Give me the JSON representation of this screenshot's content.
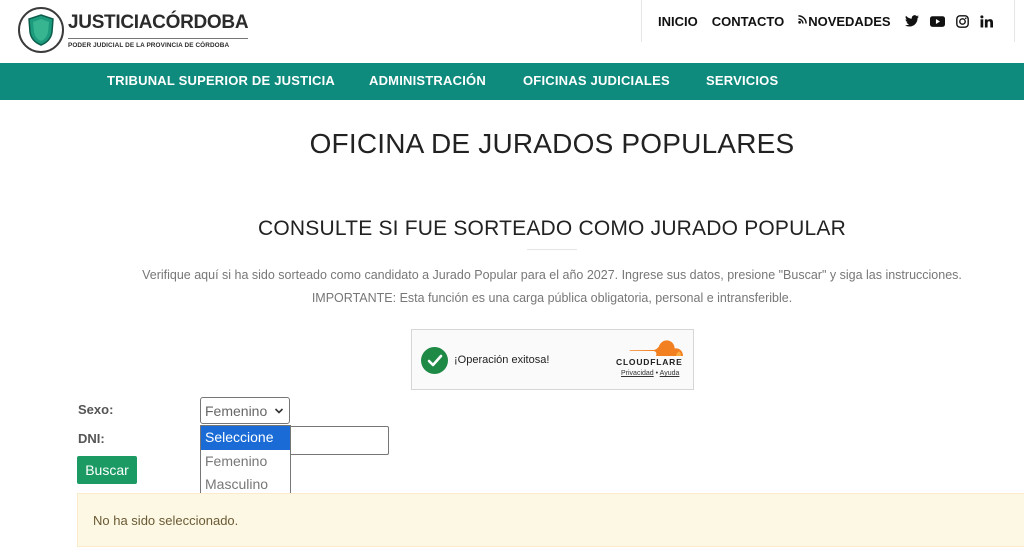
{
  "header": {
    "logo_title_main": "JUSTICIA",
    "logo_title_region": "CÓRDOBA",
    "logo_subtitle": "PODER JUDICIAL DE LA PROVINCIA DE CÓRDOBA",
    "top_links": [
      "INICIO",
      "CONTACTO",
      "NOVEDADES"
    ],
    "social_icons": [
      "twitter-icon",
      "youtube-icon",
      "instagram-icon",
      "linkedin-icon"
    ]
  },
  "main_nav": [
    "TRIBUNAL SUPERIOR DE JUSTICIA",
    "ADMINISTRACIÓN",
    "OFICINAS JUDICIALES",
    "SERVICIOS"
  ],
  "page": {
    "title": "OFICINA DE JURADOS POPULARES",
    "subtitle": "CONSULTE SI FUE SORTEADO COMO JURADO POPULAR",
    "description": "Verifique aquí si ha sido sorteado como candidato a Jurado Popular para el año 2027. Ingrese sus datos, presione \"Buscar\" y siga las instrucciones.",
    "important": "IMPORTANTE: Esta función es una carga pública obligatoria, personal e intransferible."
  },
  "captcha": {
    "message": "¡Operación exitosa!",
    "brand": "CLOUDFLARE",
    "privacy": "Privacidad",
    "separator": "•",
    "help": "Ayuda"
  },
  "form": {
    "sexo_label": "Sexo:",
    "sexo_value": "Femenino",
    "sexo_options": [
      "Seleccione",
      "Femenino",
      "Masculino"
    ],
    "sexo_highlighted": "Seleccione",
    "dni_label": "DNI:",
    "dni_value": "",
    "submit_label": "Buscar"
  },
  "alert": {
    "text": "No ha sido seleccionado."
  },
  "colors": {
    "nav_teal": "#0f8b7e",
    "button_green": "#1b9a63",
    "check_green": "#1f8a45",
    "cloudflare_orange": "#f38020",
    "alert_bg": "#fcf8e3",
    "select_highlight": "#1a6bd6"
  }
}
